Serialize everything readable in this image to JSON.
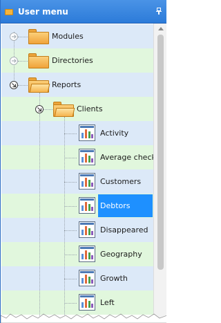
{
  "header": {
    "title": "User menu"
  },
  "tree": {
    "modules": "Modules",
    "directories": "Directories",
    "reports": "Reports",
    "clients": "Clients",
    "reports_list": [
      "Activity",
      "Average check",
      "Customers",
      "Debtors",
      "Disappeared",
      "Geography",
      "Growth",
      "Left"
    ],
    "selected_report": "Debtors"
  },
  "icons": {
    "header": "menu-icon",
    "pin": "pin-icon",
    "folder": "folder-icon",
    "folder_open": "folder-open-icon",
    "report": "report-icon",
    "expand": "expand-arrow-icon",
    "collapse": "collapse-arrow-icon"
  },
  "colors": {
    "header_bg": "#2c7bd9",
    "row_blue": "#dce9f8",
    "row_green": "#e1f7dd",
    "selection": "#1e90ff"
  }
}
